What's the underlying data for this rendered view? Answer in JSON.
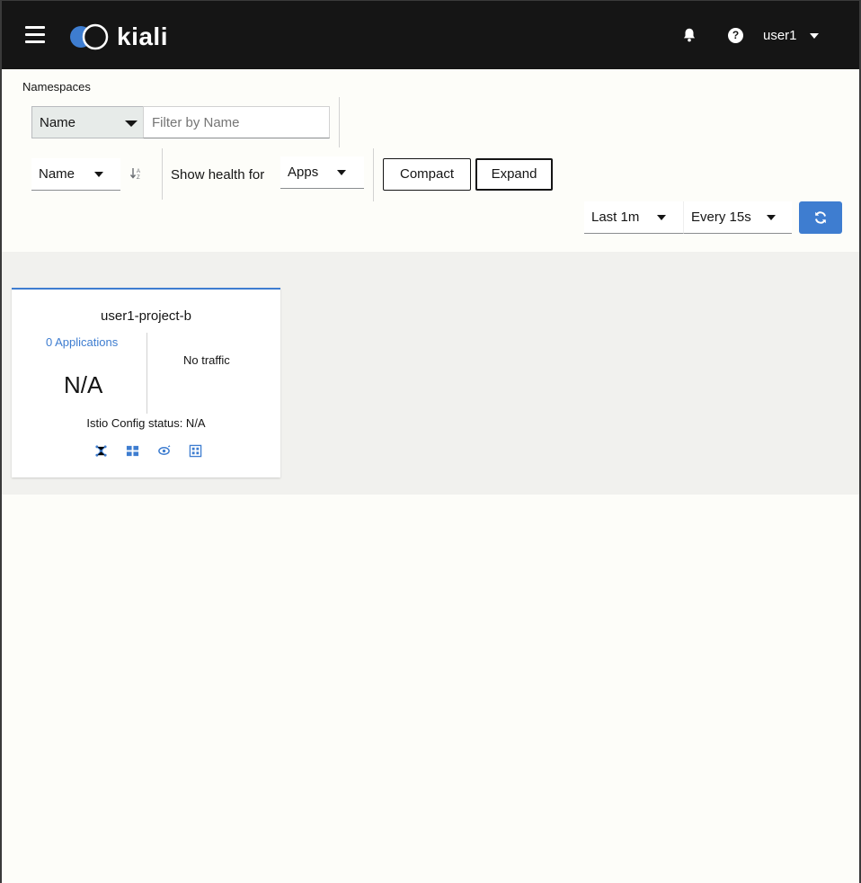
{
  "header": {
    "logo_text": "kiali",
    "user": "user1"
  },
  "breadcrumb": "Namespaces",
  "filter": {
    "type": "Name",
    "placeholder": "Filter by Name"
  },
  "sort": {
    "field": "Name"
  },
  "health": {
    "label": "Show health for",
    "value": "Apps"
  },
  "view_buttons": {
    "compact": "Compact",
    "expand": "Expand"
  },
  "time": {
    "duration": "Last 1m",
    "refresh_interval": "Every 15s"
  },
  "namespace_cards": [
    {
      "name": "user1-project-b",
      "apps_link": "0 Applications",
      "health": "N/A",
      "traffic": "No traffic",
      "istio_config": "Istio Config status: N/A"
    }
  ],
  "colors": {
    "masthead": "#151515",
    "accent": "#3e7dd0",
    "content_band": "#f1f1ee"
  }
}
